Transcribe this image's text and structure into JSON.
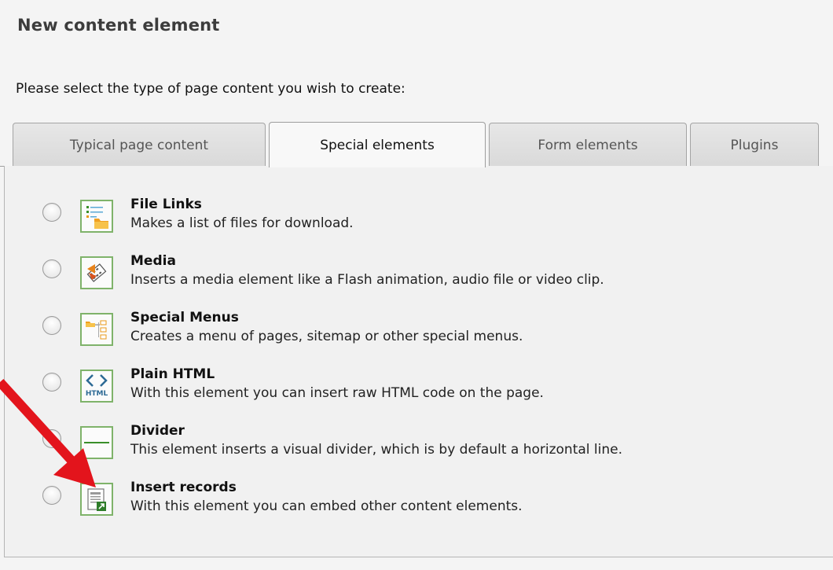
{
  "page_title": "New content element",
  "instruction": "Please select the type of page content you wish to create:",
  "tabs": [
    {
      "label": "Typical page content",
      "active": false
    },
    {
      "label": "Special elements",
      "active": true
    },
    {
      "label": "Form elements",
      "active": false
    },
    {
      "label": "Plugins",
      "active": false
    }
  ],
  "items": [
    {
      "title": "File Links",
      "description": "Makes a list of files for download.",
      "icon": "file-links-icon"
    },
    {
      "title": "Media",
      "description": "Inserts a media element like a Flash animation, audio file or video clip.",
      "icon": "media-icon"
    },
    {
      "title": "Special Menus",
      "description": "Creates a menu of pages, sitemap or other special menus.",
      "icon": "special-menus-icon"
    },
    {
      "title": "Plain HTML",
      "description": "With this element you can insert raw HTML code on the page.",
      "icon": "plain-html-icon",
      "icon_text": "HTML"
    },
    {
      "title": "Divider",
      "description": "This element inserts a visual divider, which is by default a horizontal line.",
      "icon": "divider-icon"
    },
    {
      "title": "Insert records",
      "description": "With this element you can embed other content elements.",
      "icon": "insert-records-icon"
    }
  ],
  "colors": {
    "icon_border": "#7fb36a",
    "annotation_arrow": "#e3141c",
    "active_tab": "#f8f8f8"
  }
}
